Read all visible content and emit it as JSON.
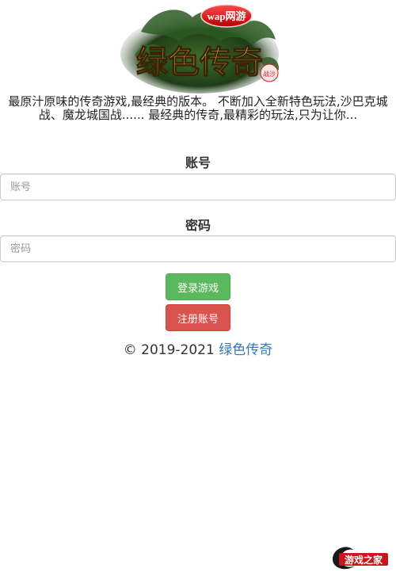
{
  "logo": {
    "badge_text": "wap网游",
    "title_text": "绿色传奇",
    "corner_text": "战沙"
  },
  "intro": {
    "text": "最原汁原味的传奇游戏,最经典的版本。 不断加入全新特色玩法,沙巴克城战、魔龙城国战...... 最经典的传奇,最精彩的玩法,只为让你..."
  },
  "account": {
    "label": "账号",
    "placeholder": "账号",
    "value": ""
  },
  "password": {
    "label": "密码",
    "placeholder": "密码",
    "value": ""
  },
  "buttons": {
    "login": "登录游戏",
    "register": "注册账号"
  },
  "footer": {
    "copyright": "© 2019-2021",
    "link_text": "绿色传奇"
  },
  "watermark": {
    "text": "游戏之家"
  },
  "colors": {
    "login_button": "#5cb85c",
    "register_button": "#d9534f",
    "link": "#337ab7"
  }
}
